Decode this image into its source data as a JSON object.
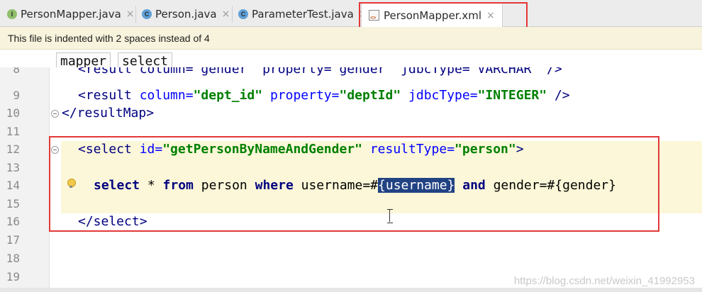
{
  "tabs": [
    {
      "label": "PersonMapper.java",
      "icon": "I",
      "icon_color": "#8fbf6a",
      "icon_name": "interface-icon"
    },
    {
      "label": "Person.java",
      "icon": "C",
      "icon_color": "#5fa0d8",
      "icon_name": "class-icon"
    },
    {
      "label": "ParameterTest.java",
      "icon": "C",
      "icon_color": "#5fa0d8",
      "icon_name": "test-class-icon"
    },
    {
      "label": "PersonMapper.xml",
      "icon_name": "xml-file-icon",
      "active": true
    }
  ],
  "close_glyph": "×",
  "banner": {
    "text": "This file is indented with 2 spaces instead of 4"
  },
  "breadcrumb": [
    "mapper",
    "select"
  ],
  "line_numbers": [
    "8",
    "9",
    "10",
    "11",
    "12",
    "13",
    "14",
    "15",
    "16",
    "17",
    "18",
    "19"
  ],
  "code": {
    "line8": "<result column=\"gender\" property=\"gender\" jdbcType=\"VARCHAR\" />",
    "line9": {
      "t1": "<result ",
      "a1": "column=",
      "s1": "\"dept_id\"",
      "a2": " property=",
      "s2": "\"deptId\"",
      "a3": " jdbcType=",
      "s3": "\"INTEGER\"",
      "t2": " />"
    },
    "line10": "</resultMap>",
    "line12": {
      "t1": "<select ",
      "a1": "id=",
      "s1": "\"getPersonByNameAndGender\"",
      "a2": " resultType=",
      "s2": "\"person\"",
      "t2": ">"
    },
    "line14": {
      "k1": "select",
      "p1": " * ",
      "k2": "from",
      "p2": " person ",
      "k3": "where",
      "p3": " username=",
      "p4": "#",
      "sel": "{username}",
      "p5": " ",
      "k4": "and",
      "p6": " gender=#{gender}"
    },
    "line16": "</select>"
  },
  "watermark": "https://blog.csdn.net/weixin_41992953",
  "colors": {
    "highlight_border": "#e33838",
    "selection": "#214283",
    "banner_bg": "#f7f3dc"
  }
}
